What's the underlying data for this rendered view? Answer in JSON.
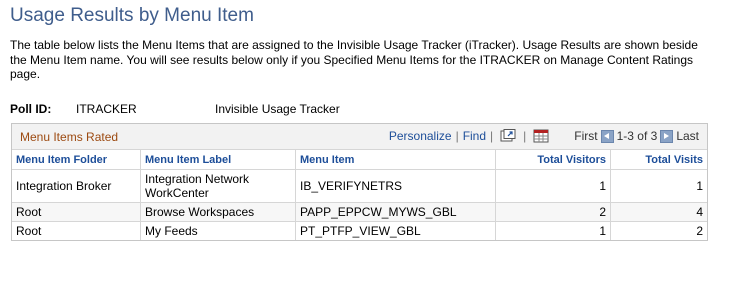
{
  "page": {
    "title": "Usage Results by Menu Item",
    "description": "The table below lists the Menu Items that are assigned to the Invisible Usage Tracker (iTracker). Usage Results are shown beside the Menu Item name. You will see results below only if you Specified Menu Items for the ITRACKER on Manage Content Ratings page."
  },
  "poll": {
    "label": "Poll ID:",
    "id": "ITRACKER",
    "name": "Invisible Usage Tracker"
  },
  "grid": {
    "title": "Menu Items Rated",
    "personalize": "Personalize",
    "find": "Find",
    "icons": [
      "view-all-icon",
      "download-spreadsheet-icon"
    ],
    "pager": {
      "first": "First",
      "range": "1-3 of 3",
      "last": "Last"
    },
    "columns": [
      "Menu Item Folder",
      "Menu Item Label",
      "Menu Item",
      "Total Visitors",
      "Total Visits"
    ],
    "rows": [
      {
        "folder": "Integration Broker",
        "label": "Integration Network WorkCenter",
        "item": "IB_VERIFYNETRS",
        "visitors": "1",
        "visits": "1"
      },
      {
        "folder": "Root",
        "label": "Browse Workspaces",
        "item": "PAPP_EPPCW_MYWS_GBL",
        "visitors": "2",
        "visits": "4"
      },
      {
        "folder": "Root",
        "label": "My Feeds",
        "item": "PT_PTFP_VIEW_GBL",
        "visitors": "1",
        "visits": "2"
      }
    ]
  },
  "colors": {
    "title": "#3f5d8c",
    "link": "#1d4e99",
    "grid_title": "#9c4a11"
  }
}
